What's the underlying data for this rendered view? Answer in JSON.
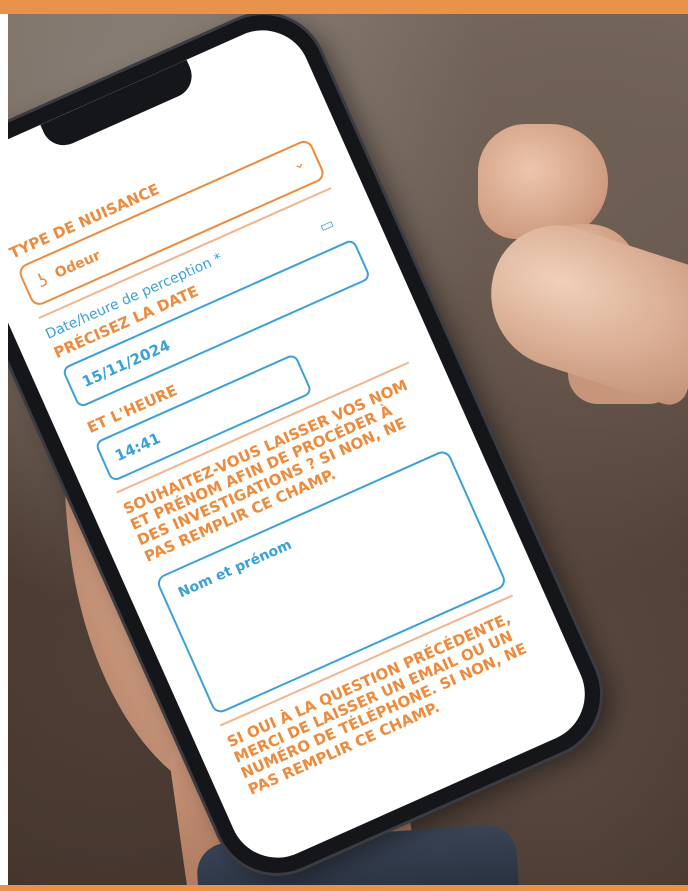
{
  "form": {
    "type_label": "TYPE DE NUISANCE",
    "type_value": "Odeur",
    "type_icon": "nose-icon",
    "datetime_label": "Date/heure de perception *",
    "date_label": "PRÉCISEZ LA DATE",
    "date_value": "15/11/2024",
    "date_icon": "calendar-icon",
    "time_label": "ET L'HEURE",
    "time_value": "14:41",
    "name_question": "SOUHAITEZ-VOUS LAISSER VOS NOM ET PRÉNOM AFIN DE PROCÉDER À DES INVESTIGATIONS ? SI NON, NE PAS REMPLIR CE CHAMP.",
    "name_placeholder": "Nom et prénom",
    "contact_question": "SI OUI À LA QUESTION PRÉCÉDENTE, MERCI DE LAISSER UN EMAIL OU UN NUMÉRO DE TÉLÉPHONE. SI NON, NE PAS REMPLIR CE CHAMP."
  },
  "colors": {
    "accent_orange": "#ee8a3c",
    "accent_blue": "#3aa0d8",
    "band_orange": "#e8924a"
  }
}
